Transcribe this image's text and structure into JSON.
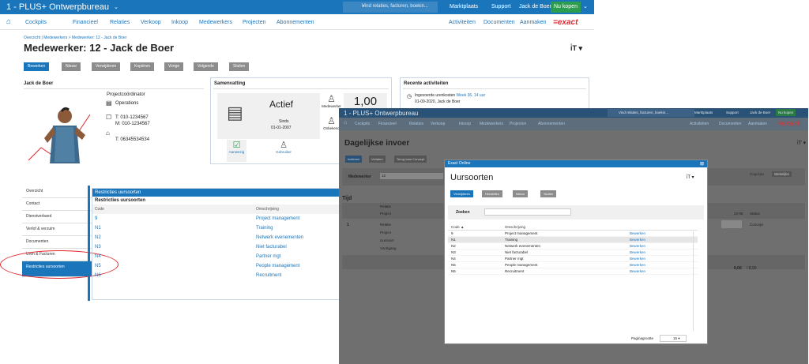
{
  "app": {
    "title": "1 - PLUS+ Ontwerpbureau",
    "search_placeholder": "Vind relaties, facturen, boekin...",
    "links": [
      "Marktplaats",
      "Support",
      "Jack de Boer"
    ],
    "buy": "Nu kopen"
  },
  "nav": {
    "items": [
      "Cockpits",
      "Financieel",
      "Relaties",
      "Verkoop",
      "Inkoop",
      "Medewerkers",
      "Projecten",
      "Abonnementen"
    ],
    "right": [
      "Activiteiten",
      "Documenten",
      "Aanmaken"
    ],
    "logo": "=exact"
  },
  "page": {
    "breadcrumb": "Overzicht | Medewerkers > Medewerker: 12 - Jack de Boer",
    "title": "Medewerker: 12 - Jack de Boer"
  },
  "toolbar": [
    "Bewerken",
    "Nieuw",
    "Verwijderen",
    "Kopiëren",
    "Vorige",
    "Volgende",
    "Sluiten"
  ],
  "person": {
    "name": "Jack de Boer",
    "role": "Projectcoördinator",
    "dept": "Operations",
    "phone": "T: 010-1234567",
    "mobile": "M: 010-1234567",
    "phone2": "T: 06345534534"
  },
  "summary": {
    "header": "Samenvatting",
    "status": "Actief",
    "since_label": "Sinds",
    "since_date": "01-01-2007",
    "medewerker": "Medewerker",
    "onbekend": "Onbekend",
    "value": "1,00",
    "aanwezig": "Aanwezig",
    "gebruiker": "Gebruiker"
  },
  "recent": {
    "header": "Recente activiteiten",
    "item": "Ingevoerde urenkosten",
    "week": "Week 36, 14 uur",
    "date": "01-09-2020, Jack de Boer"
  },
  "tabs": [
    "Overzicht",
    "Contact",
    "Dienstverband",
    "Verlof & verzuim",
    "Documenten",
    "Uren & Facturen",
    "Restricties uursoorten"
  ],
  "restr": {
    "header": "Restricties uursoorten",
    "sub": "Restricties uursoorten",
    "col_code": "Code",
    "col_desc": "Omschrijving",
    "rows": [
      [
        "9",
        "Project management"
      ],
      [
        "N1",
        "Training"
      ],
      [
        "N2",
        "Netwerk evenementen"
      ],
      [
        "N3",
        "Niet facturabel"
      ],
      [
        "N4",
        "Partner mgt"
      ],
      [
        "N5",
        "People management"
      ],
      [
        "N6",
        "Recruitment"
      ]
    ]
  },
  "overlay": {
    "title": "1 - PLUS+ Ontwerpbureau",
    "search": "Vind relaties, facturen, boekin...",
    "links": [
      "Marktplaats",
      "Support",
      "Jack de Boer"
    ],
    "buy": "Nu kopen",
    "nav": [
      "Cockpits",
      "Financieel",
      "Relaties",
      "Verkoop",
      "Inkoop",
      "Medewerkers",
      "Projecten",
      "Abonnementen"
    ],
    "nav_right": [
      "Activiteiten",
      "Documenten",
      "Aanmaken"
    ],
    "logo": "=exact",
    "page_title": "Dagelijkse invoer",
    "buttons": [
      "Indienen",
      "Verlaten",
      "Terug naar Concept"
    ],
    "medewerker_label": "Medewerker",
    "medewerker_val": "12",
    "tijd": "Tijd",
    "labels": [
      "Relatie",
      "Project",
      "Uursoort",
      "Voortgang"
    ],
    "row_no": "1",
    "status_label": "Status",
    "status_val": "Concept",
    "date_col": "23-08",
    "total": "0,00",
    "total2": "/ 8,00",
    "right_btns": [
      "Dagelijks",
      "Wekelijks"
    ]
  },
  "modal": {
    "header": "Exact Online",
    "title": "Uursoorten",
    "buttons": [
      "Verwijderen",
      "Herstellen",
      "Nieuw",
      "Sluiten"
    ],
    "search_label": "Zoeken",
    "col_code": "Code ▲",
    "col_desc": "Omschrijving",
    "action": "Bewerken",
    "rows": [
      [
        "9",
        "Project management"
      ],
      [
        "N1",
        "Training"
      ],
      [
        "N2",
        "Netwerk evenementen"
      ],
      [
        "N3",
        "Niet facturabel"
      ],
      [
        "N4",
        "Partner mgt"
      ],
      [
        "N5",
        "People management"
      ],
      [
        "N6",
        "Recruitment"
      ]
    ],
    "pagesize_label": "Paginagrootte",
    "pagesize": "15"
  }
}
